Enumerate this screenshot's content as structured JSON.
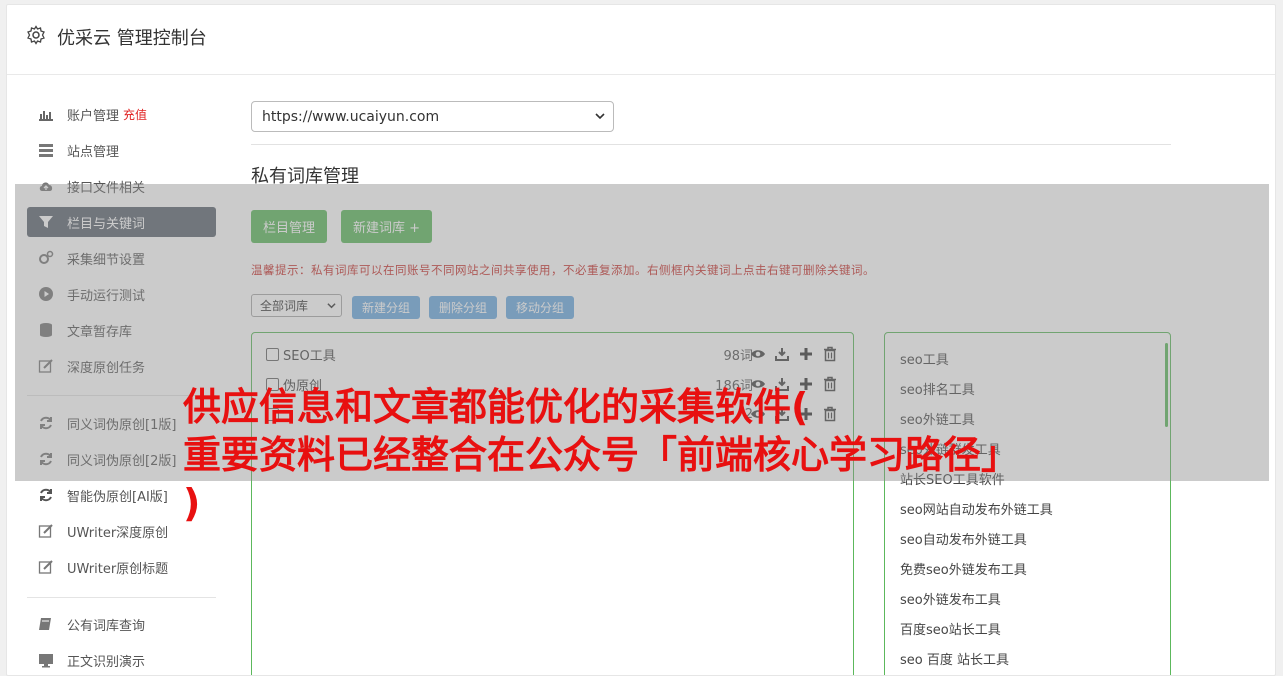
{
  "header": {
    "title": "优采云 管理控制台",
    "icon": "gear-icon"
  },
  "sidebar": {
    "items": [
      {
        "label": "账户管理",
        "extra": "充值",
        "icon": "bar-chart-icon"
      },
      {
        "label": "站点管理",
        "icon": "server-icon"
      },
      {
        "label": "接口文件相关",
        "icon": "cloud-upload-icon"
      },
      {
        "label": "栏目与关键词",
        "icon": "filter-icon",
        "active": true
      },
      {
        "label": "采集细节设置",
        "icon": "cogs-icon"
      },
      {
        "label": "手动运行测试",
        "icon": "play-circle-icon"
      },
      {
        "label": "文章暂存库",
        "icon": "database-icon"
      },
      {
        "label": "深度原创任务",
        "icon": "edit-icon"
      },
      {
        "label": "同义词伪原创[1版]",
        "icon": "refresh-icon"
      },
      {
        "label": "同义词伪原创[2版]",
        "icon": "refresh-icon"
      },
      {
        "label": "智能伪原创[AI版]",
        "icon": "refresh-icon"
      },
      {
        "label": "UWriter深度原创",
        "icon": "edit-icon"
      },
      {
        "label": "UWriter原创标题",
        "icon": "edit-icon"
      },
      {
        "label": "公有词库查询",
        "icon": "book-icon"
      },
      {
        "label": "正文识别演示",
        "icon": "monitor-icon"
      }
    ]
  },
  "main": {
    "site_select": "https://www.ucaiyun.com",
    "section_title": "私有词库管理",
    "btn_column": "栏目管理",
    "btn_new_lib": "新建词库 +",
    "tip": "温馨提示：私有词库可以在同账号不同网站之间共享使用，不必重复添加。右侧框内关键词上点击右键可删除关键词。",
    "group_select": "全部词库",
    "btn_new_group": "新建分组",
    "btn_del_group": "删除分组",
    "btn_move_group": "移动分组",
    "libraries": [
      {
        "name": "SEO工具",
        "count": "98词"
      },
      {
        "name": "伪原创",
        "count": "186词"
      },
      {
        "name": "",
        "count": "2"
      }
    ],
    "keywords": [
      "seo工具",
      "seo排名工具",
      "seo外链工具",
      "seo外链群发工具",
      "站长SEO工具软件",
      "seo网站自动发布外链工具",
      "seo自动发布外链工具",
      "免费seo外链发布工具",
      "seo外链发布工具",
      "百度seo站长工具",
      "seo 百度 站长工具"
    ]
  },
  "overlay": {
    "line1": "供应信息和文章都能优化的采集软件(",
    "line2": "重要资料已经整合在公众号「前端核心学习路径」",
    "line3": ")"
  }
}
